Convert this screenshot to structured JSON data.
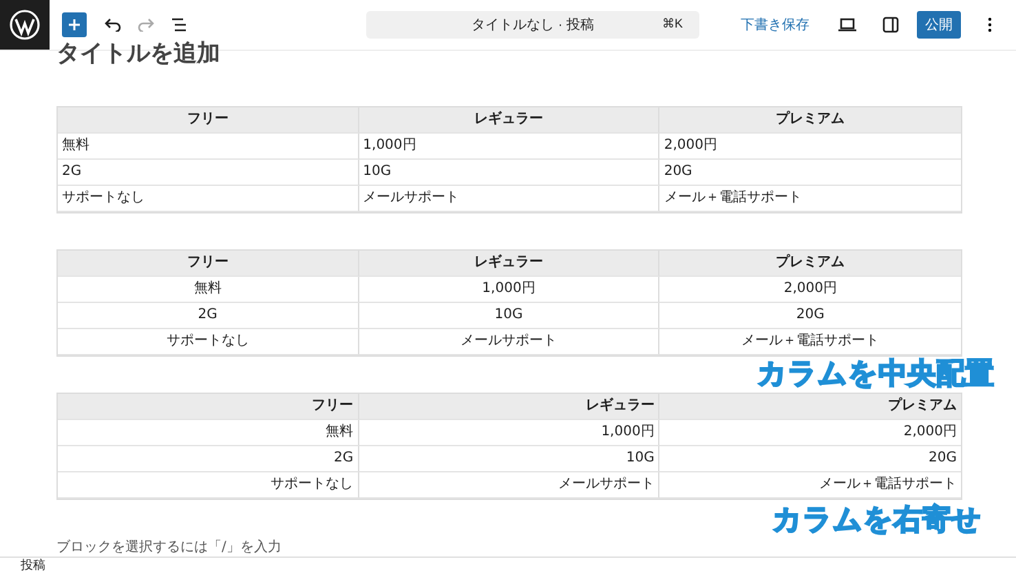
{
  "toolbar": {
    "document_title": "タイトルなし · 投稿",
    "shortcut": "⌘K",
    "save_draft": "下書き保存",
    "publish": "公開"
  },
  "post_title": "タイトルを追加",
  "tables": [
    {
      "kind": "left",
      "header": [
        "フリー",
        "レギュラー",
        "プレミアム"
      ],
      "rows": [
        [
          "無料",
          "1,000円",
          "2,000円"
        ],
        [
          "2G",
          "10G",
          "20G"
        ],
        [
          "サポートなし",
          "メールサポート",
          "メール＋電話サポート"
        ]
      ]
    },
    {
      "kind": "center",
      "header": [
        "フリー",
        "レギュラー",
        "プレミアム"
      ],
      "rows": [
        [
          "無料",
          "1,000円",
          "2,000円"
        ],
        [
          "2G",
          "10G",
          "20G"
        ],
        [
          "サポートなし",
          "メールサポート",
          "メール＋電話サポート"
        ]
      ]
    },
    {
      "kind": "right",
      "header": [
        "フリー",
        "レギュラー",
        "プレミアム"
      ],
      "rows": [
        [
          "無料",
          "1,000円",
          "2,000円"
        ],
        [
          "2G",
          "10G",
          "20G"
        ],
        [
          "サポートなし",
          "メールサポート",
          "メール＋電話サポート"
        ]
      ]
    }
  ],
  "annotations": [
    "カラムを中央配置",
    "カラムを右寄せ"
  ],
  "block_placeholder": "ブロックを選択するには「/」を入力",
  "footer": {
    "breadcrumb": "投稿"
  }
}
